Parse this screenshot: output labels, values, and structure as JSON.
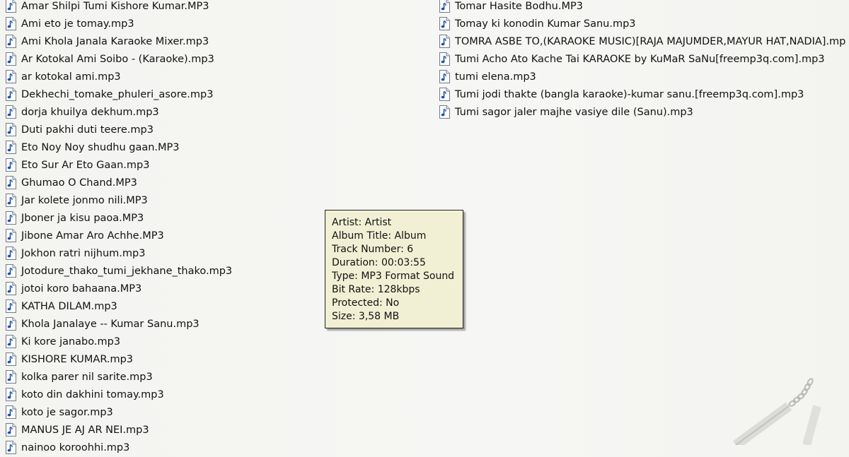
{
  "files_left": [
    "Amar Shilpi Tumi Kishore Kumar.MP3",
    "Ami eto je tomay.mp3",
    "Ami Khola Janala Karaoke Mixer.mp3",
    "Ar Kotokal Ami Soibo - (Karaoke).mp3",
    "ar kotokal ami.mp3",
    "Dekhechi_tomake_phuleri_asore.mp3",
    "dorja khuilya dekhum.mp3",
    "Duti pakhi duti teere.mp3",
    "Eto Noy Noy shudhu gaan.MP3",
    "Eto Sur Ar Eto Gaan.mp3",
    "Ghumao O Chand.MP3",
    "Jar kolete jonmo nili.MP3",
    "Jboner ja kisu paoa.MP3",
    "Jibone Amar Aro Achhe.MP3",
    "Jokhon ratri nijhum.mp3",
    "Jotodure_thako_tumi_jekhane_thako.mp3",
    "jotoi koro bahaana.MP3",
    "KATHA DILAM.mp3",
    "Khola Janalaye -- Kumar Sanu.mp3",
    "Ki kore janabo.mp3",
    "KISHORE KUMAR.mp3",
    "kolka parer nil sarite.mp3",
    "koto din dakhini  tomay.mp3",
    "koto je sagor.mp3",
    "MANUS JE AJ AR NEI.mp3",
    "nainoo koroohhi.mp3"
  ],
  "files_right": [
    "Tomar Hasite Bodhu.MP3",
    "Tomay ki konodin Kumar Sanu.mp3",
    "TOMRA ASBE TO,(KARAOKE MUSIC)[RAJA MAJUMDER,MAYUR HAT,NADIA].mp",
    "Tumi Acho Ato Kache Tai KARAOKE by KuMaR SaNu[freemp3q.com].mp3",
    "tumi elena.mp3",
    "Tumi jodi thakte (bangla karaoke)-kumar sanu.[freemp3q.com].mp3",
    "Tumi sagor jaler majhe vasiye dile (Sanu).mp3"
  ],
  "tooltip": {
    "artist": "Artist: Artist",
    "album": "Album Title: Album",
    "track": "Track Number: 6",
    "duration": "Duration: 00:03:55",
    "type": "Type: MP3 Format Sound",
    "bitrate": "Bit Rate: 128kbps",
    "protected": "Protected: No",
    "size": "Size: 3,58 MB"
  },
  "icons": {
    "file": "audio-file-icon",
    "watermark": "nunchaku-watermark-icon"
  },
  "colors": {
    "background": "#f5f5f2",
    "tooltip_bg": "#f1f0d4",
    "icon_note": "#1c4fb0"
  }
}
